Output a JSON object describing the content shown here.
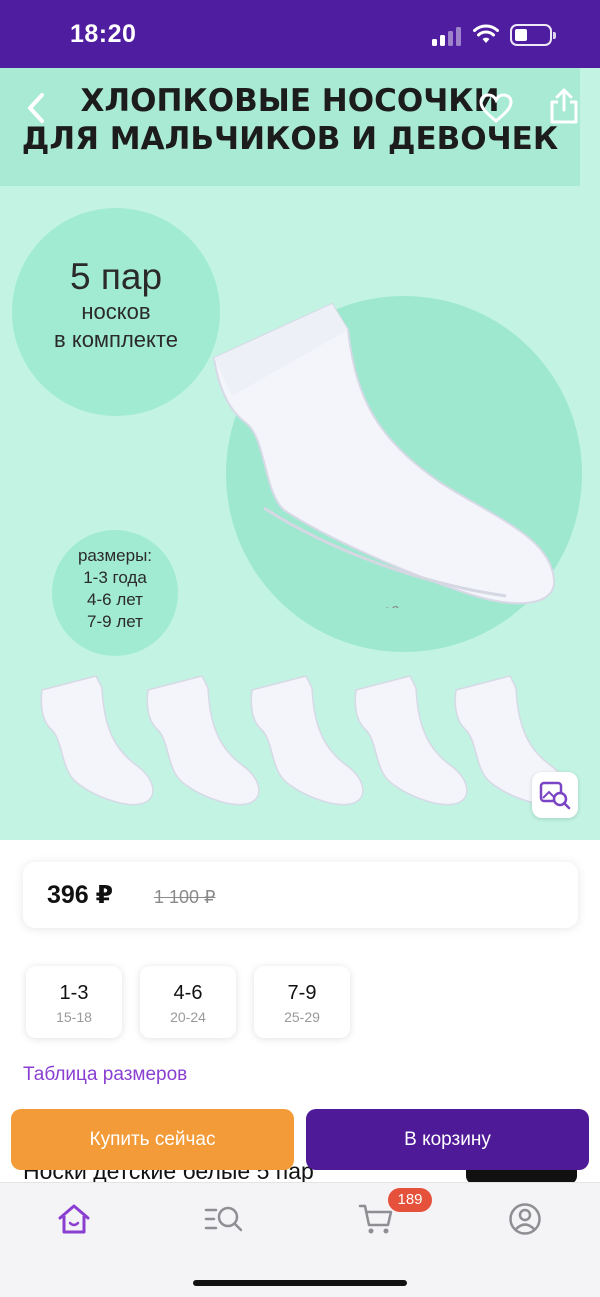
{
  "status_bar": {
    "time": "18:20"
  },
  "product_image": {
    "title_line1": "ХЛОПКОВЫЕ НОСОЧКИ",
    "title_line2": "ДЛЯ МАЛЬЧИКОВ И ДЕВОЧЕК",
    "pack_count": "5 пар",
    "pack_line2": "носков",
    "pack_line3": "в комплекте",
    "sizes_heading": "размеры:",
    "sizes": [
      "1-3 года",
      "4-6 лет",
      "7-9 лет"
    ],
    "sock_brand_mark": "ЗЗ"
  },
  "price": {
    "current": "396 ₽",
    "old": "1 100 ₽"
  },
  "size_options": [
    {
      "label": "1-3",
      "sub": "15-18"
    },
    {
      "label": "4-6",
      "sub": "20-24"
    },
    {
      "label": "7-9",
      "sub": "25-29"
    }
  ],
  "size_table_link": "Таблица размеров",
  "actions": {
    "buy_now": "Купить сейчас",
    "add_to_cart": "В корзину"
  },
  "product_title_partial": "Носки детские белые 5 пар",
  "tab_bar": {
    "cart_badge": "189"
  },
  "colors": {
    "brand_purple": "#4f1ea0",
    "orange": "#f29b38",
    "link": "#8a3fd1",
    "mint": "#c2f3e3",
    "badge": "#e5513a"
  }
}
